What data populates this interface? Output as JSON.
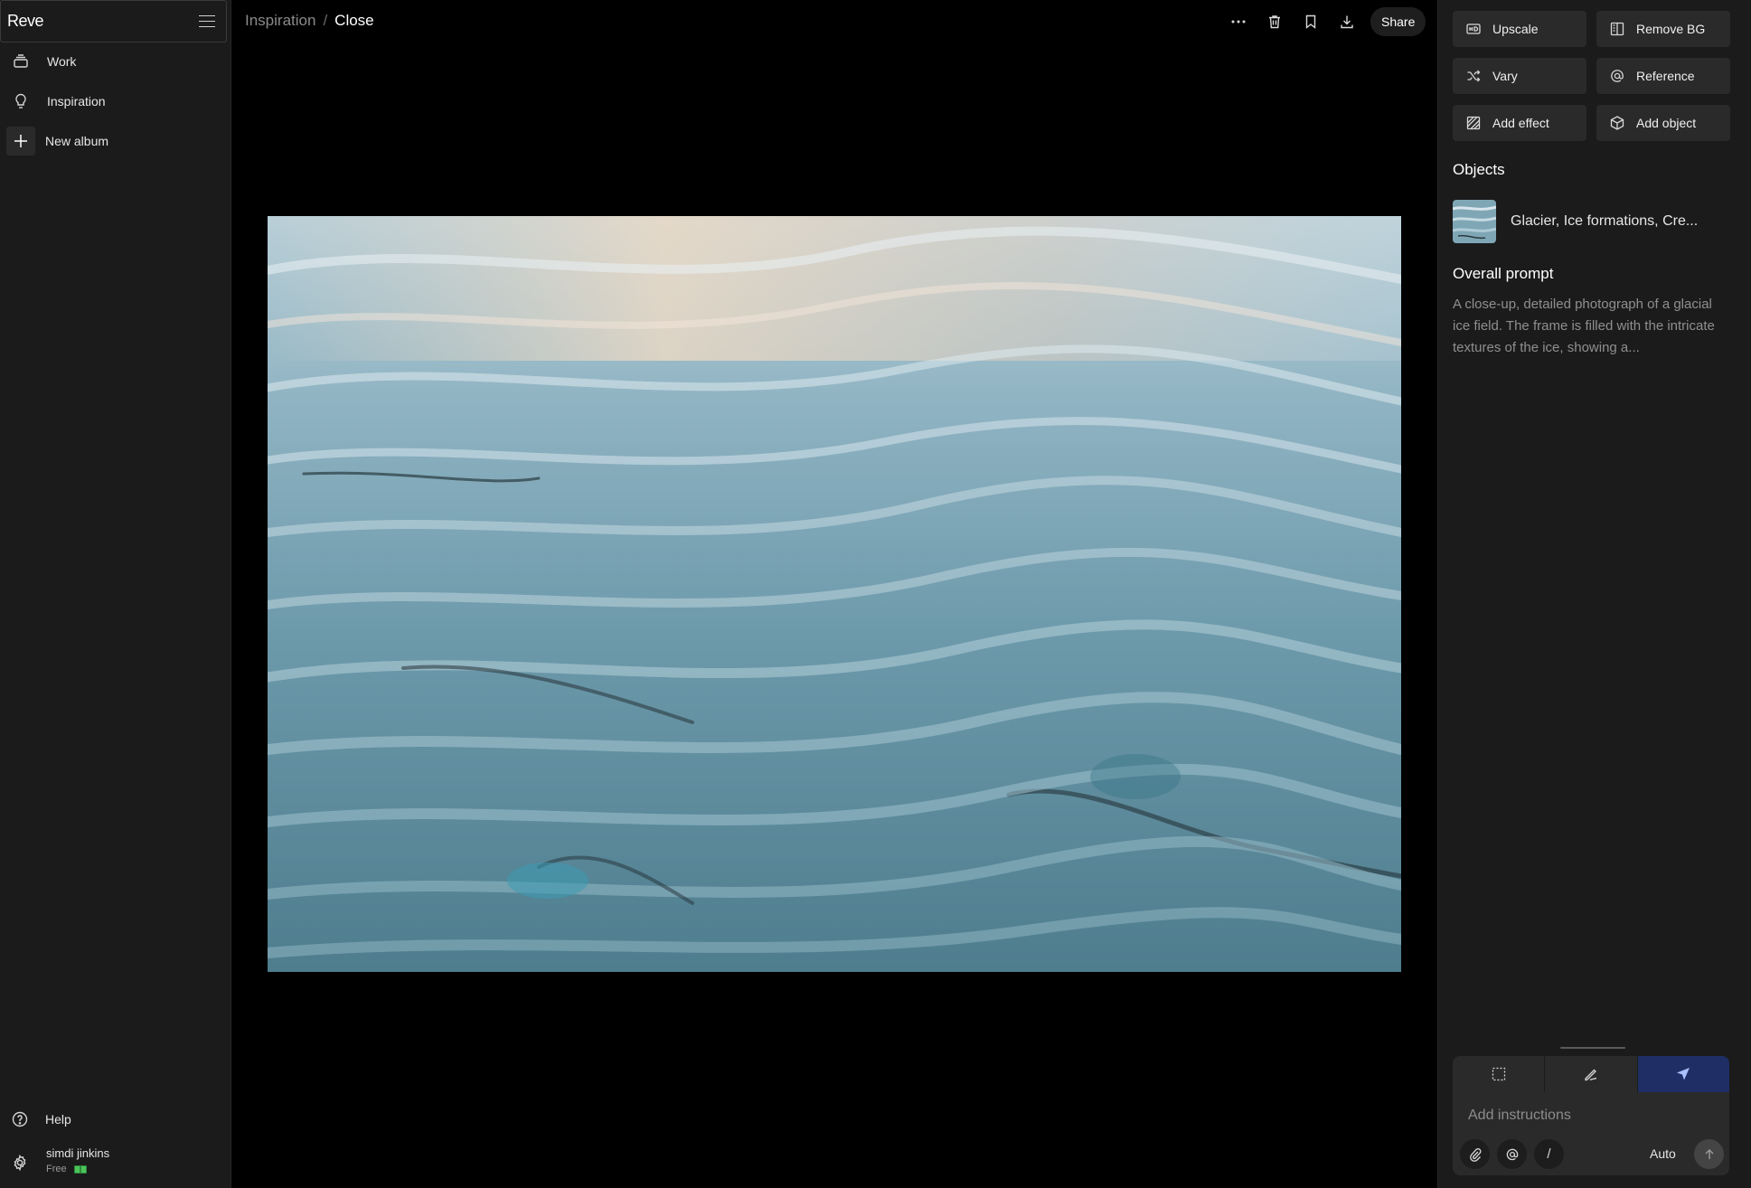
{
  "app": {
    "brand": "Reve"
  },
  "sidebar": {
    "items": [
      {
        "label": "Work",
        "icon": "stack-icon"
      },
      {
        "label": "Inspiration",
        "icon": "lightbulb-icon"
      },
      {
        "label": "New album",
        "icon": "plus-icon"
      }
    ],
    "help_label": "Help",
    "user": {
      "name": "simdi jinkins",
      "plan": "Free"
    }
  },
  "header": {
    "breadcrumb": {
      "parent": "Inspiration",
      "separator": "/",
      "current": "Close"
    },
    "share_label": "Share",
    "icons": [
      "more-icon",
      "trash-icon",
      "bookmark-icon",
      "download-icon"
    ]
  },
  "canvas": {
    "image_subject": "glacier-ice-field"
  },
  "panel": {
    "actions": [
      {
        "label": "Upscale",
        "icon": "hd-icon"
      },
      {
        "label": "Remove BG",
        "icon": "remove-bg-icon"
      },
      {
        "label": "Vary",
        "icon": "shuffle-icon"
      },
      {
        "label": "Reference",
        "icon": "at-icon"
      },
      {
        "label": "Add effect",
        "icon": "effect-icon"
      },
      {
        "label": "Add object",
        "icon": "cube-icon"
      }
    ],
    "objects_title": "Objects",
    "object_label": "Glacier, Ice formations, Cre...",
    "prompt_title": "Overall prompt",
    "prompt_text": "A close-up, detailed photograph of a glacial ice field. The frame is filled with the intricate textures of the ice, showing a...",
    "composer": {
      "placeholder": "Add instructions",
      "auto_label": "Auto",
      "active_mode": "pointer",
      "slash": "/"
    }
  },
  "colors": {
    "accent": "#1f2e64",
    "accent_icon": "#a9c1ff",
    "plan_badge": "#4cc35a"
  }
}
